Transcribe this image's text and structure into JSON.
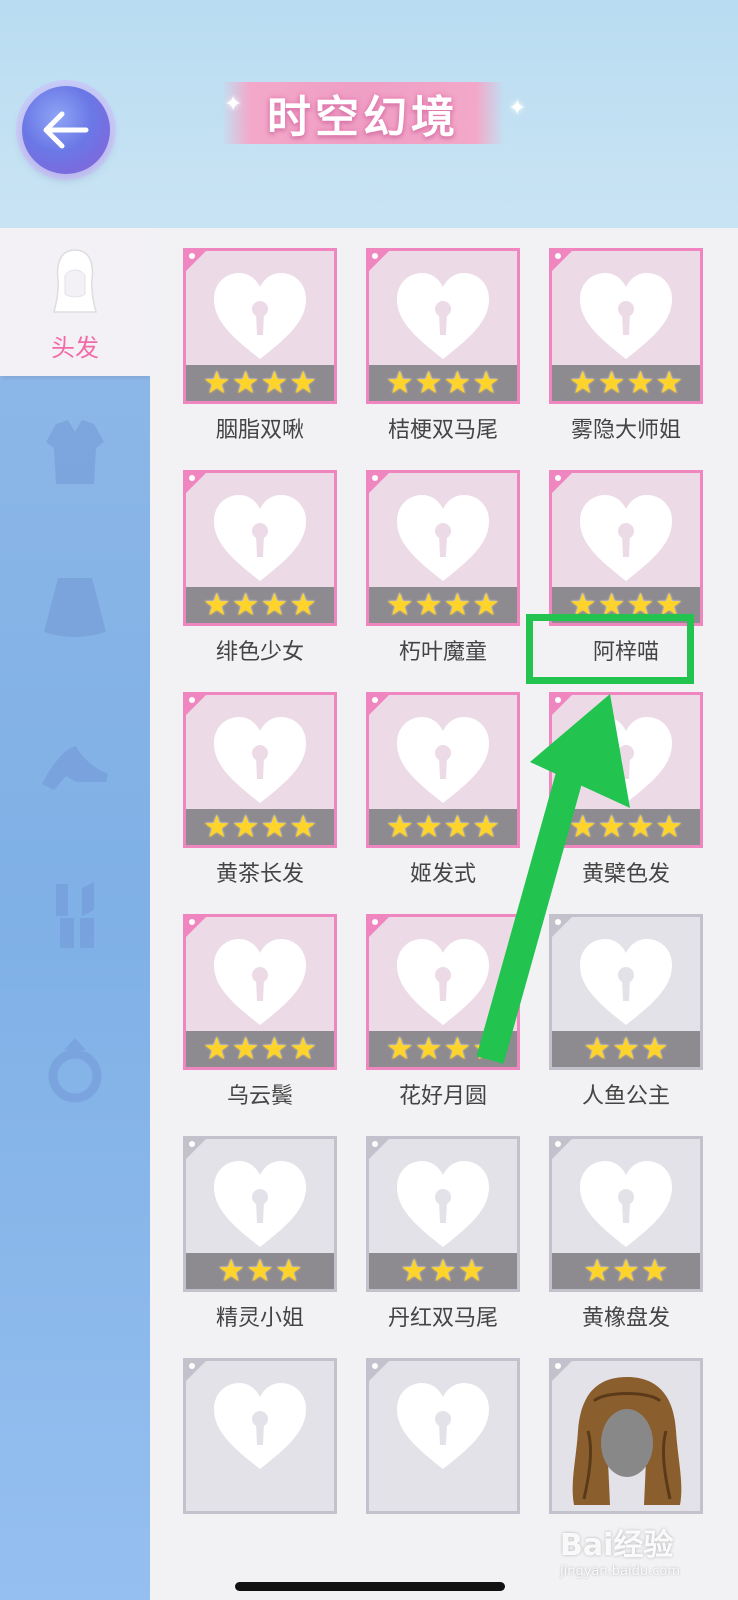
{
  "header": {
    "title": "时空幻境"
  },
  "sidebar": {
    "active_label": "头发",
    "items": [
      {
        "icon": "hair-icon",
        "label": "头发"
      },
      {
        "icon": "top-clothes-icon"
      },
      {
        "icon": "skirt-icon"
      },
      {
        "icon": "shoes-icon"
      },
      {
        "icon": "lipstick-icon"
      },
      {
        "icon": "ring-icon"
      }
    ]
  },
  "items": [
    {
      "name": "胭脂双啾",
      "stars": 4,
      "tier": "pink"
    },
    {
      "name": "桔梗双马尾",
      "stars": 4,
      "tier": "pink"
    },
    {
      "name": "雾隐大师姐",
      "stars": 4,
      "tier": "pink"
    },
    {
      "name": "绯色少女",
      "stars": 4,
      "tier": "pink"
    },
    {
      "name": "朽叶魔童",
      "stars": 4,
      "tier": "pink"
    },
    {
      "name": "阿梓喵",
      "stars": 4,
      "tier": "pink"
    },
    {
      "name": "黄茶长发",
      "stars": 4,
      "tier": "pink"
    },
    {
      "name": "姬发式",
      "stars": 4,
      "tier": "pink"
    },
    {
      "name": "黄檗色发",
      "stars": 4,
      "tier": "pink"
    },
    {
      "name": "乌云鬓",
      "stars": 4,
      "tier": "pink"
    },
    {
      "name": "花好月圆",
      "stars": 4,
      "tier": "pink"
    },
    {
      "name": "人鱼公主",
      "stars": 3,
      "tier": "grey"
    },
    {
      "name": "精灵小姐",
      "stars": 3,
      "tier": "grey"
    },
    {
      "name": "丹红双马尾",
      "stars": 3,
      "tier": "grey"
    },
    {
      "name": "黄橡盘发",
      "stars": 3,
      "tier": "grey"
    },
    {
      "name": "",
      "stars": 0,
      "tier": "grey"
    },
    {
      "name": "",
      "stars": 0,
      "tier": "grey"
    },
    {
      "name": "",
      "stars": 0,
      "tier": "grey",
      "thumb": "hair-portrait"
    }
  ],
  "annotation": {
    "highlighted_item": "阿梓喵",
    "color": "#22c34e"
  },
  "watermark": {
    "text": "Bai经验",
    "sub": "jingyan.baidu.com"
  }
}
